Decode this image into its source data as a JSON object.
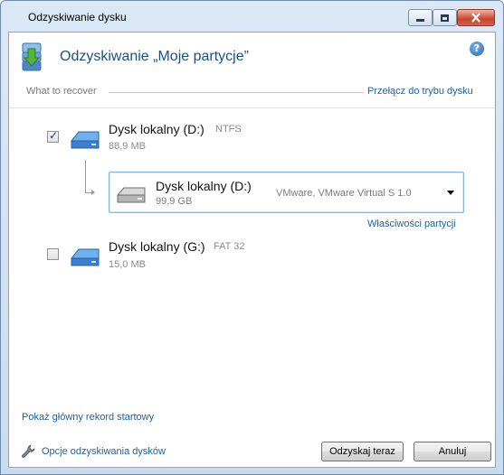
{
  "window": {
    "title": "Odzyskiwanie dysku"
  },
  "header": {
    "title": "Odzyskiwanie „Moje partycje”",
    "help_glyph": "?"
  },
  "section": {
    "label": "What to recover",
    "mode_link": "Przełącz do trybu dysku"
  },
  "items": [
    {
      "checked": true,
      "name": "Dysk lokalny (D:)",
      "fs": "NTFS",
      "size": "88,9 MB",
      "icon": "hard-disk-icon"
    },
    {
      "checked": false,
      "name": "Dysk lokalny (G:)",
      "fs": "FAT 32",
      "size": "15,0 MB",
      "icon": "hard-disk-icon"
    }
  ],
  "target": {
    "name": "Dysk lokalny (D:)",
    "size": "99,9 GB",
    "device": "VMware, VMware Virtual S 1.0",
    "icon": "gray-disk-icon"
  },
  "links": {
    "partition_properties": "Właściwości partycji",
    "mbr": "Pokaż główny rekord startowy",
    "options": "Opcje odzyskiwania dysków"
  },
  "buttons": {
    "recover": "Odzyskaj teraz",
    "cancel": "Anuluj"
  },
  "colors": {
    "link": "#1c5fb0",
    "title": "#1b4f8c",
    "disk_blue": "#3a7fd4"
  }
}
